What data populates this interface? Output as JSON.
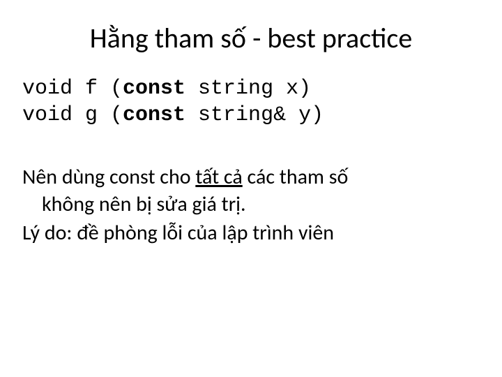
{
  "title": "Hằng tham số - best practice",
  "code": {
    "line1": {
      "pre": "void f (",
      "kw": "const",
      "post": " string x)"
    },
    "line2": {
      "pre": "void g (",
      "kw": "const",
      "post": " string& y)"
    }
  },
  "body": {
    "p1a": "Nên dùng const cho ",
    "p1u": "tất cả",
    "p1b": " các tham số",
    "p1c": "không nên bị sửa giá trị.",
    "p2": "Lý do: đề phòng lỗi của lập trình viên"
  }
}
